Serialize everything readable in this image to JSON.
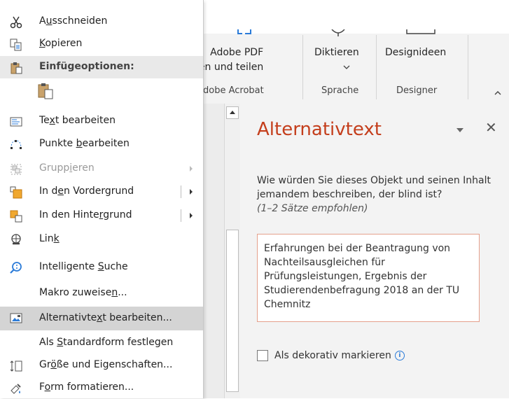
{
  "ribbon": {
    "groups": [
      {
        "button": "Adobe PDF",
        "button2": "tellen und teilen",
        "group": "dobe Acrobat"
      },
      {
        "button": "Diktieren",
        "group": "Sprache"
      },
      {
        "button": "Designideen",
        "group": "Designer"
      }
    ]
  },
  "pane": {
    "title": "Alternativtext",
    "question": "Wie würden Sie dieses Objekt und seinen Inhalt jemandem beschreiben, der blind ist?",
    "hint": "(1–2 Sätze empfohlen)",
    "text": "Erfahrungen bei der Beantragung von Nachteilsausgleichen für Prüfungsleistungen, Ergebnis der Studierendenbefragung 2018 an der TU Chemnitz",
    "checkbox_label": "Als dekorativ markieren",
    "checkbox_checked": false
  },
  "menu": {
    "items": [
      {
        "pre": "A",
        "ul": "u",
        "post": "sschneiden",
        "icon": "scissors-icon"
      },
      {
        "pre": "",
        "ul": "K",
        "post": "opieren",
        "icon": "copy-icon"
      },
      {
        "pre": "Einfügeoptionen:",
        "ul": "",
        "post": "",
        "icon": "clipboard-icon"
      },
      {
        "pre": "",
        "ul": "",
        "post": "",
        "icon": "paste-option-icon"
      },
      {
        "pre": "Te",
        "ul": "x",
        "post": "t bearbeiten",
        "icon": "edit-text-icon"
      },
      {
        "pre": "Punkte ",
        "ul": "b",
        "post": "earbeiten",
        "icon": "edit-points-icon"
      },
      {
        "pre": "Grupp",
        "ul": "i",
        "post": "eren",
        "icon": "group-icon"
      },
      {
        "pre": "In d",
        "ul": "e",
        "post": "n Vordergrund",
        "icon": "bring-forward-icon"
      },
      {
        "pre": "In den Hinte",
        "ul": "r",
        "post": "grund",
        "icon": "send-backward-icon"
      },
      {
        "pre": "Lin",
        "ul": "k",
        "post": "",
        "icon": "link-icon"
      },
      {
        "pre": "Intelligente ",
        "ul": "S",
        "post": "uche",
        "icon": "smart-lookup-icon"
      },
      {
        "pre": "Makro zuweise",
        "ul": "n",
        "post": "...",
        "icon": ""
      },
      {
        "pre": "Alternativte",
        "ul": "x",
        "post": "t bearbeiten...",
        "icon": "alt-text-icon"
      },
      {
        "pre": "Als ",
        "ul": "S",
        "post": "tandardform festlegen",
        "icon": ""
      },
      {
        "pre": "Gr",
        "ul": "ö",
        "post": "ße und Eigenschaften...",
        "icon": "size-properties-icon"
      },
      {
        "pre": "F",
        "ul": "o",
        "post": "rm formatieren...",
        "icon": "format-shape-icon"
      }
    ]
  },
  "colors": {
    "accent": "#c43e1c",
    "highlight": "#d4d4d4",
    "info": "#2b7bd8"
  }
}
